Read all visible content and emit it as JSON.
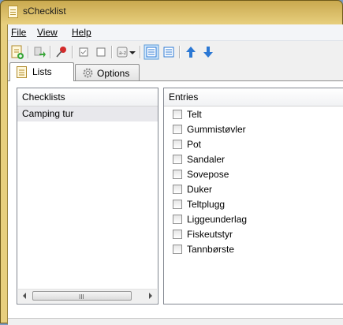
{
  "window": {
    "title": "sChecklist"
  },
  "menu": {
    "file": "File",
    "view": "View",
    "help": "Help"
  },
  "toolbar": {
    "icons": [
      "new-list-icon",
      "move-icon",
      "pin-icon",
      "check-all-icon",
      "uncheck-all-icon",
      "sort-icon",
      "dropdown-arrow-icon",
      "view-details-icon",
      "view-list-icon",
      "move-up-icon",
      "move-down-icon"
    ],
    "accent_color": "#2b78d4"
  },
  "tabs": [
    {
      "label": "Lists",
      "icon": "checklist-icon",
      "active": true
    },
    {
      "label": "Options",
      "icon": "gear-icon",
      "active": false
    }
  ],
  "checklists": {
    "header": "Checklists",
    "items": [
      "Camping tur"
    ],
    "selected_index": 0
  },
  "entries": {
    "header": "Entries",
    "items": [
      {
        "label": "Telt",
        "checked": false
      },
      {
        "label": "Gummistøvler",
        "checked": false
      },
      {
        "label": "Pot",
        "checked": false
      },
      {
        "label": "Sandaler",
        "checked": false
      },
      {
        "label": "Sovepose",
        "checked": false
      },
      {
        "label": "Duker",
        "checked": false
      },
      {
        "label": "Teltplugg",
        "checked": false
      },
      {
        "label": "Liggeunderlag",
        "checked": false
      },
      {
        "label": "Fiskeutstyr",
        "checked": false
      },
      {
        "label": "Tannbørste",
        "checked": false
      }
    ]
  },
  "scrollbar": {
    "grip": "III"
  }
}
